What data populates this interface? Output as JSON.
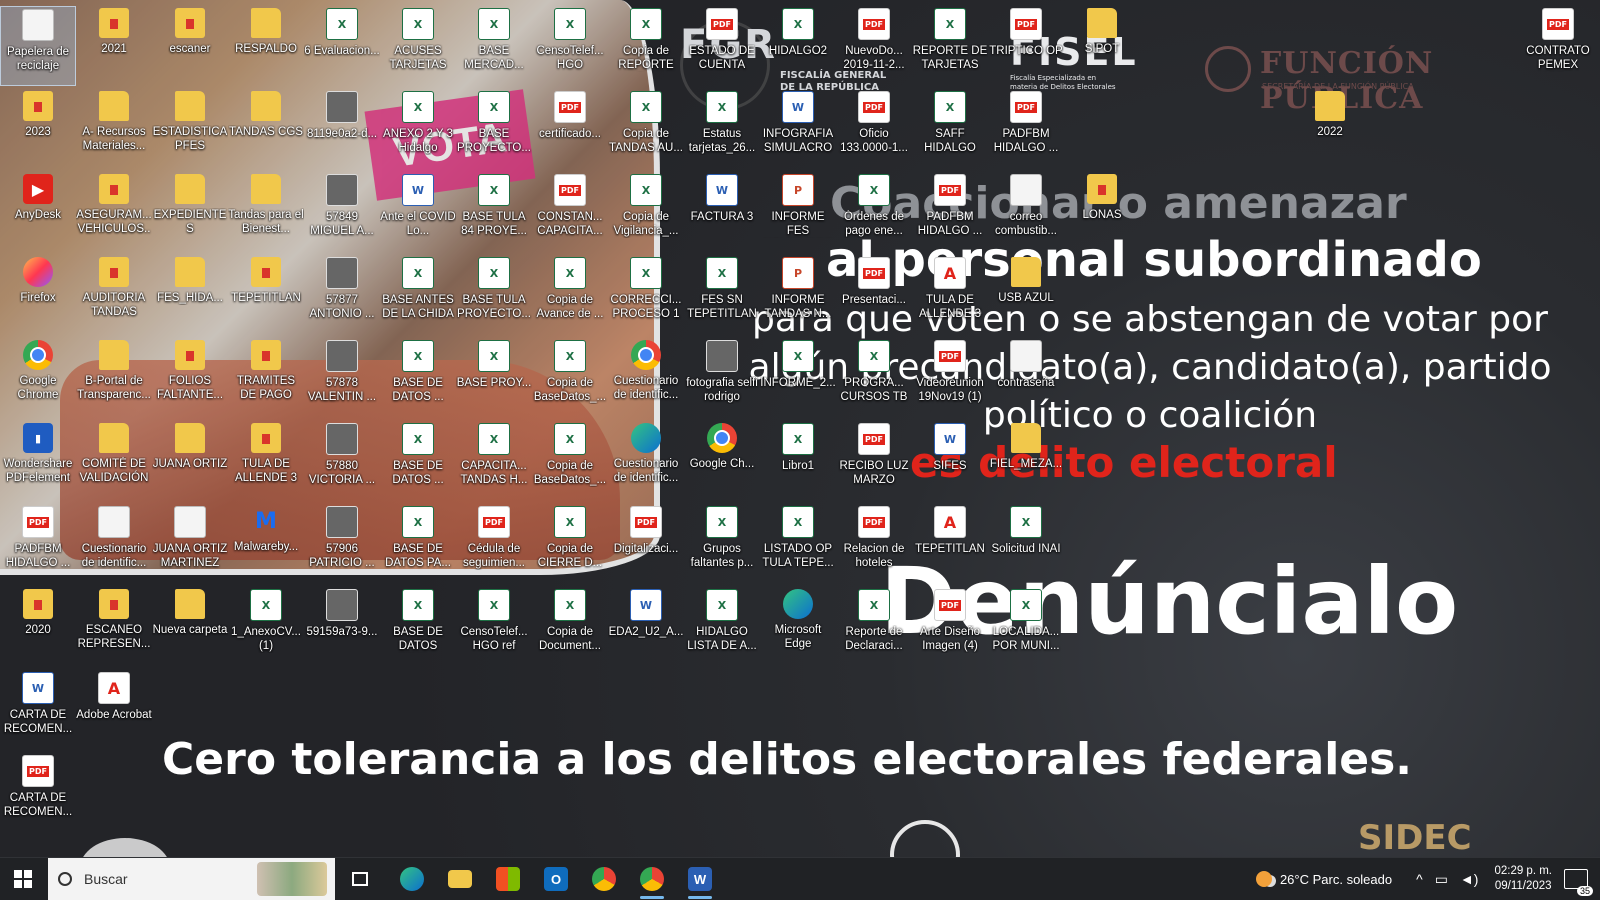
{
  "wallpaper": {
    "fge": "FGR",
    "fge_sub": "FISCALÍA GENERAL DE LA REPÚBLICA",
    "fisel": "FISEL",
    "fisel_sub": "Fiscalía Especializada en materia de Delitos Electorales",
    "funcion_publica": "FUNCIÓN PÚBLICA",
    "funcion_publica_sub": "SECRETARÍA DE LA FUNCIÓN PÚBLICA",
    "line1": "Coaccionar o amenazar",
    "line2": "al personal subordinado",
    "line3": "para que voten o se abstengan de votar por algún precandidato(a), candidato(a), partido político o coalición",
    "line4": "es delito electoral",
    "denuncialo": "Denúncialo",
    "cero": "Cero tolerancia a los delitos electorales federales.",
    "sidec": "SIDEC",
    "photo_sign": "VOTA"
  },
  "icons": [
    {
      "label": "Papelera de reciclaje",
      "type": "file",
      "col": 0,
      "row": 0,
      "selected": true
    },
    {
      "label": "2021",
      "type": "folder-red",
      "col": 1,
      "row": 0
    },
    {
      "label": "escaner",
      "type": "folder-red",
      "col": 2,
      "row": 0
    },
    {
      "label": "RESPALDO",
      "type": "folder",
      "col": 3,
      "row": 0
    },
    {
      "label": "6 Evaluacion...",
      "type": "excel",
      "col": 4,
      "row": 0
    },
    {
      "label": "ACUSES TARJETAS",
      "type": "excel",
      "col": 5,
      "row": 0
    },
    {
      "label": "BASE MERCAD...",
      "type": "excel",
      "col": 6,
      "row": 0
    },
    {
      "label": "CensoTelef... HGO",
      "type": "excel",
      "col": 7,
      "row": 0
    },
    {
      "label": "Copia de REPORTE D...",
      "type": "excel",
      "col": 8,
      "row": 0
    },
    {
      "label": "ESTADO DE CUENTA",
      "type": "pdf",
      "col": 9,
      "row": 0
    },
    {
      "label": "HIDALGO2",
      "type": "excel",
      "col": 10,
      "row": 0
    },
    {
      "label": "NuevoDo... 2019-11-2...",
      "type": "pdf",
      "col": 11,
      "row": 0
    },
    {
      "label": "REPORTE DE TARJETAS",
      "type": "excel",
      "col": 12,
      "row": 0
    },
    {
      "label": "TRIPTICO OP",
      "type": "pdf",
      "col": 13,
      "row": 0
    },
    {
      "label": "SIPOT",
      "type": "folder",
      "col": 14,
      "row": 0
    },
    {
      "label": "CONTRATO PEMEX ABR...",
      "type": "pdf",
      "col": 20,
      "row": 0
    },
    {
      "label": "2023",
      "type": "folder-red",
      "col": 0,
      "row": 1
    },
    {
      "label": "A- Recursos Materiales...",
      "type": "folder",
      "col": 1,
      "row": 1
    },
    {
      "label": "ESTADISTICA PFES",
      "type": "folder",
      "col": 2,
      "row": 1
    },
    {
      "label": "TANDAS CGS",
      "type": "folder",
      "col": 3,
      "row": 1
    },
    {
      "label": "8119e0a2-d...",
      "type": "img",
      "col": 4,
      "row": 1
    },
    {
      "label": "ANEXO 2 Y 3 Hidalgo",
      "type": "excel",
      "col": 5,
      "row": 1
    },
    {
      "label": "BASE PROYECTO...",
      "type": "excel",
      "col": 6,
      "row": 1
    },
    {
      "label": "certificado...",
      "type": "pdf",
      "col": 7,
      "row": 1
    },
    {
      "label": "Copia de TANDAS AU...",
      "type": "excel",
      "col": 8,
      "row": 1
    },
    {
      "label": "Estatus tarjetas_26...",
      "type": "excel",
      "col": 9,
      "row": 1
    },
    {
      "label": "INFOGRAFIA SIMULACRO",
      "type": "word",
      "col": 10,
      "row": 1
    },
    {
      "label": "Oficio 133.0000-1...",
      "type": "pdf",
      "col": 11,
      "row": 1
    },
    {
      "label": "SAFF HIDALGO",
      "type": "excel",
      "col": 12,
      "row": 1
    },
    {
      "label": "PADFBM HIDALGO ...",
      "type": "pdf",
      "col": 13,
      "row": 1
    },
    {
      "label": "2022",
      "type": "folder",
      "col": 17,
      "row": 1
    },
    {
      "label": "AnyDesk",
      "type": "app",
      "col": 0,
      "row": 2
    },
    {
      "label": "ASEGURAM... VEHICULOS...",
      "type": "folder-red",
      "col": 1,
      "row": 2
    },
    {
      "label": "EXPEDIENTES",
      "type": "folder",
      "col": 2,
      "row": 2
    },
    {
      "label": "Tandas para el Bienest...",
      "type": "folder",
      "col": 3,
      "row": 2
    },
    {
      "label": "57849 MIGUEL A...",
      "type": "img",
      "col": 4,
      "row": 2
    },
    {
      "label": "Ante el COVID Lo...",
      "type": "word",
      "col": 5,
      "row": 2
    },
    {
      "label": "BASE TULA 84 PROYE...",
      "type": "excel",
      "col": 6,
      "row": 2
    },
    {
      "label": "CONSTAN... CAPACITA...",
      "type": "pdf",
      "col": 7,
      "row": 2
    },
    {
      "label": "Copia de Vigilancia_...",
      "type": "excel",
      "col": 8,
      "row": 2
    },
    {
      "label": "FACTURA 3",
      "type": "word",
      "col": 9,
      "row": 2
    },
    {
      "label": "INFORME FES NOVIEMBRE",
      "type": "ppt",
      "col": 10,
      "row": 2
    },
    {
      "label": "Órdenes de pago ene...",
      "type": "excel",
      "col": 11,
      "row": 2
    },
    {
      "label": "PADFBM HIDALGO ...",
      "type": "pdf",
      "col": 12,
      "row": 2
    },
    {
      "label": "correo combustib...",
      "type": "file",
      "col": 13,
      "row": 2
    },
    {
      "label": "LONAS",
      "type": "folder-red",
      "col": 14,
      "row": 2
    },
    {
      "label": "Firefox",
      "type": "firefox",
      "col": 0,
      "row": 3
    },
    {
      "label": "AUDITORIA TANDAS",
      "type": "folder-red",
      "col": 1,
      "row": 3
    },
    {
      "label": "FES_HIDA...",
      "type": "folder",
      "col": 2,
      "row": 3
    },
    {
      "label": "TEPETITLAN",
      "type": "folder-red",
      "col": 3,
      "row": 3
    },
    {
      "label": "57877 ANTONIO ...",
      "type": "img",
      "col": 4,
      "row": 3
    },
    {
      "label": "BASE ANTES DE LA CHIDA",
      "type": "excel",
      "col": 5,
      "row": 3
    },
    {
      "label": "BASE TULA PROYECTO...",
      "type": "excel",
      "col": 6,
      "row": 3
    },
    {
      "label": "Copia de Avance de ...",
      "type": "excel",
      "col": 7,
      "row": 3
    },
    {
      "label": "CORRECCI... PROCESO 1",
      "type": "excel",
      "col": 8,
      "row": 3
    },
    {
      "label": "FES SN TEPETITLAN",
      "type": "excel",
      "col": 9,
      "row": 3
    },
    {
      "label": "INFORME TANDAS N...",
      "type": "ppt",
      "col": 10,
      "row": 3
    },
    {
      "label": "Presentaci...",
      "type": "pdf",
      "col": 11,
      "row": 3
    },
    {
      "label": "TULA DE ALLENDE 3",
      "type": "pdf2",
      "col": 12,
      "row": 3
    },
    {
      "label": "USB AZUL",
      "type": "folder",
      "col": 13,
      "row": 3
    },
    {
      "label": "Google Chrome",
      "type": "chrome",
      "col": 0,
      "row": 4
    },
    {
      "label": "B-Portal de Transparenc...",
      "type": "folder",
      "col": 1,
      "row": 4
    },
    {
      "label": "FOLIOS FALTANTE...",
      "type": "folder-red",
      "col": 2,
      "row": 4
    },
    {
      "label": "TRAMITES DE PAGO",
      "type": "folder-red",
      "col": 3,
      "row": 4
    },
    {
      "label": "57878 VALENTIN ...",
      "type": "img",
      "col": 4,
      "row": 4
    },
    {
      "label": "BASE DE DATOS ...",
      "type": "excel",
      "col": 5,
      "row": 4
    },
    {
      "label": "BASE PROY...",
      "type": "excel",
      "col": 6,
      "row": 4
    },
    {
      "label": "Copia de BaseDatos_...",
      "type": "excel",
      "col": 7,
      "row": 4
    },
    {
      "label": "Cuestionario de identific...",
      "type": "chrome",
      "col": 8,
      "row": 4
    },
    {
      "label": "fotografia selfi rodrigo",
      "type": "img",
      "col": 9,
      "row": 4
    },
    {
      "label": "INFORME_2...",
      "type": "excel",
      "col": 10,
      "row": 4
    },
    {
      "label": "PROGRA... CURSOS TB",
      "type": "excel",
      "col": 11,
      "row": 4
    },
    {
      "label": "Videoreunion 19Nov19 (1)",
      "type": "pdf",
      "col": 12,
      "row": 4
    },
    {
      "label": "contraseña",
      "type": "file",
      "col": 13,
      "row": 4
    },
    {
      "label": "Wondershare PDFelement",
      "type": "wonder",
      "col": 0,
      "row": 5
    },
    {
      "label": "COMITÉ DE VALIDACIÓN",
      "type": "folder",
      "col": 1,
      "row": 5
    },
    {
      "label": "JUANA ORTIZ",
      "type": "folder",
      "col": 2,
      "row": 5
    },
    {
      "label": "TULA DE ALLENDE 3",
      "type": "folder-red",
      "col": 3,
      "row": 5
    },
    {
      "label": "57880 VICTORIA ...",
      "type": "img",
      "col": 4,
      "row": 5
    },
    {
      "label": "BASE DE DATOS ...",
      "type": "excel",
      "col": 5,
      "row": 5
    },
    {
      "label": "CAPACITA... TANDAS H...",
      "type": "excel",
      "col": 6,
      "row": 5
    },
    {
      "label": "Copia de BaseDatos_...",
      "type": "excel",
      "col": 7,
      "row": 5
    },
    {
      "label": "Cuestionario de identific...",
      "type": "edge",
      "col": 8,
      "row": 5
    },
    {
      "label": "Google Ch...",
      "type": "chrome",
      "col": 9,
      "row": 5
    },
    {
      "label": "Libro1",
      "type": "excel",
      "col": 10,
      "row": 5
    },
    {
      "label": "RECIBO LUZ MARZO",
      "type": "pdf",
      "col": 11,
      "row": 5
    },
    {
      "label": "SIFES",
      "type": "word",
      "col": 12,
      "row": 5
    },
    {
      "label": "FIEL_MEZA...",
      "type": "folder",
      "col": 13,
      "row": 5
    },
    {
      "label": "PADFBM HIDALGO ...",
      "type": "pdf",
      "col": 0,
      "row": 6
    },
    {
      "label": "Cuestionario de identific...",
      "type": "file",
      "col": 1,
      "row": 6
    },
    {
      "label": "JUANA ORTIZ MARTINEZ",
      "type": "file",
      "col": 2,
      "row": 6
    },
    {
      "label": "Malwareby...",
      "type": "malware",
      "col": 3,
      "row": 6
    },
    {
      "label": "57906 PATRICIO ...",
      "type": "img",
      "col": 4,
      "row": 6
    },
    {
      "label": "BASE DE DATOS PA...",
      "type": "excel",
      "col": 5,
      "row": 6
    },
    {
      "label": "Cédula de seguimien...",
      "type": "pdf",
      "col": 6,
      "row": 6
    },
    {
      "label": "Copia de CIERRE D...",
      "type": "excel",
      "col": 7,
      "row": 6
    },
    {
      "label": "Digitalizaci...",
      "type": "pdf",
      "col": 8,
      "row": 6
    },
    {
      "label": "Grupos faltantes p...",
      "type": "excel",
      "col": 9,
      "row": 6
    },
    {
      "label": "LISTADO OP TULA TEPE...",
      "type": "excel",
      "col": 10,
      "row": 6
    },
    {
      "label": "Relacion de hoteles",
      "type": "pdf",
      "col": 11,
      "row": 6
    },
    {
      "label": "TEPETITLAN",
      "type": "pdf2",
      "col": 12,
      "row": 6
    },
    {
      "label": "Solicitud INAI",
      "type": "excel",
      "col": 13,
      "row": 6
    },
    {
      "label": "2020",
      "type": "folder-red",
      "col": 0,
      "row": 7
    },
    {
      "label": "ESCANEO REPRESEN...",
      "type": "folder-red",
      "col": 1,
      "row": 7
    },
    {
      "label": "Nueva carpeta",
      "type": "folder",
      "col": 2,
      "row": 7
    },
    {
      "label": "1_AnexoCV... (1)",
      "type": "excel",
      "col": 3,
      "row": 7
    },
    {
      "label": "59159a73-9...",
      "type": "img",
      "col": 4,
      "row": 7
    },
    {
      "label": "BASE DE DATOS REGI...",
      "type": "excel",
      "col": 5,
      "row": 7
    },
    {
      "label": "CensoTelef... HGO ref",
      "type": "excel",
      "col": 6,
      "row": 7
    },
    {
      "label": "Copia de Document...",
      "type": "excel",
      "col": 7,
      "row": 7
    },
    {
      "label": "EDA2_U2_A...",
      "type": "word",
      "col": 8,
      "row": 7
    },
    {
      "label": "HIDALGO LISTA DE A...",
      "type": "excel",
      "col": 9,
      "row": 7
    },
    {
      "label": "Microsoft Edge",
      "type": "edge",
      "col": 10,
      "row": 7
    },
    {
      "label": "Reporte de Declaraci...",
      "type": "excel",
      "col": 11,
      "row": 7
    },
    {
      "label": "Arte Diseño Imagen (4)",
      "type": "pdf",
      "col": 12,
      "row": 7
    },
    {
      "label": "LOCALIDA... POR MUNI...",
      "type": "excel",
      "col": 13,
      "row": 7
    },
    {
      "label": "CARTA DE RECOMEN...",
      "type": "word",
      "col": 0,
      "row": 8
    },
    {
      "label": "Adobe Acrobat",
      "type": "pdf2",
      "col": 1,
      "row": 8
    },
    {
      "label": "CARTA DE RECOMEN...",
      "type": "pdf",
      "col": 0,
      "row": 9
    }
  ],
  "taskbar": {
    "search_placeholder": "Buscar",
    "apps": [
      "task-view",
      "edge",
      "file-explorer",
      "store",
      "outlook",
      "chrome",
      "chrome-profile",
      "word"
    ],
    "weather": "26°C  Parc. soleado",
    "time": "02:29 p. m.",
    "date": "09/11/2023",
    "notifications": "35"
  }
}
